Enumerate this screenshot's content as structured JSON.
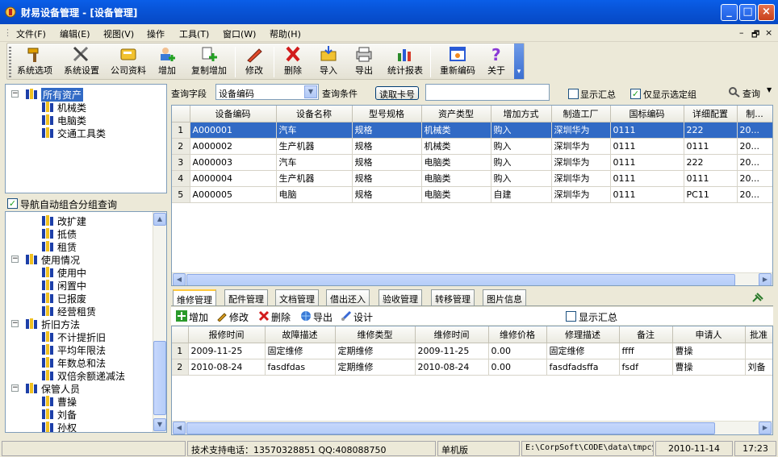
{
  "window": {
    "title": "财易设备管理 - [设备管理]"
  },
  "menu": [
    "文件(F)",
    "编辑(E)",
    "视图(V)",
    "操作",
    "工具(T)",
    "窗口(W)",
    "帮助(H)"
  ],
  "toolbar": [
    "系统选项",
    "系统设置",
    "公司资料",
    "增加",
    "复制增加",
    "修改",
    "删除",
    "导入",
    "导出",
    "统计报表",
    "重新编码",
    "关于"
  ],
  "tree_top": [
    {
      "label": "所有资产",
      "level": 0,
      "selected": true
    },
    {
      "label": "机械类",
      "level": 1
    },
    {
      "label": "电脑类",
      "level": 1
    },
    {
      "label": "交通工具类",
      "level": 1
    }
  ],
  "nav_group_label": "导航自动组合分组查询",
  "tree_bottom": [
    {
      "label": "改扩建",
      "level": 1
    },
    {
      "label": "抵债",
      "level": 1
    },
    {
      "label": "租赁",
      "level": 1
    },
    {
      "label": "使用情况",
      "level": 0
    },
    {
      "label": "使用中",
      "level": 1
    },
    {
      "label": "闲置中",
      "level": 1
    },
    {
      "label": "已报废",
      "level": 1
    },
    {
      "label": "经营租赁",
      "level": 1
    },
    {
      "label": "折旧方法",
      "level": 0
    },
    {
      "label": "不计提折旧",
      "level": 1
    },
    {
      "label": "平均年限法",
      "level": 1
    },
    {
      "label": "年数总和法",
      "level": 1
    },
    {
      "label": "双倍余额递减法",
      "level": 1
    },
    {
      "label": "保管人员",
      "level": 0
    },
    {
      "label": "曹操",
      "level": 1
    },
    {
      "label": "刘备",
      "level": 1
    },
    {
      "label": "孙权",
      "level": 1
    }
  ],
  "query": {
    "field_label": "查询字段",
    "field_value": "设备编码",
    "condition_label": "查询条件",
    "read_card": "读取卡号",
    "input_value": "",
    "show_summary": "显示汇总",
    "only_selected": "仅显示选定组",
    "search": "查询"
  },
  "main_table": {
    "columns": [
      "设备编码",
      "设备名称",
      "型号规格",
      "资产类型",
      "增加方式",
      "制造工厂",
      "国标编码",
      "详细配置",
      "制..."
    ],
    "rows": [
      [
        "A000001",
        "汽车",
        "规格",
        "机械类",
        "购入",
        "深圳华为",
        "0111",
        "222",
        "20..."
      ],
      [
        "A000002",
        "生产机器",
        "规格",
        "机械类",
        "购入",
        "深圳华为",
        "0111",
        "0111",
        "20..."
      ],
      [
        "A000003",
        "汽车",
        "规格",
        "电脑类",
        "购入",
        "深圳华为",
        "0111",
        "222",
        "20..."
      ],
      [
        "A000004",
        "生产机器",
        "规格",
        "电脑类",
        "购入",
        "深圳华为",
        "0111",
        "0111",
        "20..."
      ],
      [
        "A000005",
        "电脑",
        "规格",
        "电脑类",
        "自建",
        "深圳华为",
        "0111",
        "PC11",
        "20..."
      ]
    ]
  },
  "tabs": [
    "维修管理",
    "配件管理",
    "文档管理",
    "借出还入",
    "验收管理",
    "转移管理",
    "图片信息"
  ],
  "sub_toolbar": [
    "增加",
    "修改",
    "删除",
    "导出",
    "设计"
  ],
  "sub_show_summary": "显示汇总",
  "repair_table": {
    "columns": [
      "报修时间",
      "故障描述",
      "维修类型",
      "维修时间",
      "维修价格",
      "修理描述",
      "备注",
      "申请人",
      "批准"
    ],
    "rows": [
      [
        "2009-11-25",
        "固定维修",
        "定期维修",
        "2009-11-25",
        "0.00",
        "固定维修",
        "ffff",
        "曹操",
        ""
      ],
      [
        "2010-08-24",
        "fasdfdas",
        "定期维修",
        "2010-08-24",
        "0.00",
        "fasdfadsffa",
        "fsdf",
        "曹操",
        "刘备"
      ]
    ]
  },
  "status": {
    "support": "技术支持电话：13570328851 QQ:408088750",
    "mode": "单机版",
    "path": "E:\\CorpSoft\\CODE\\data\\tmpcy",
    "date": "2010-11-14",
    "time": "17:23"
  }
}
